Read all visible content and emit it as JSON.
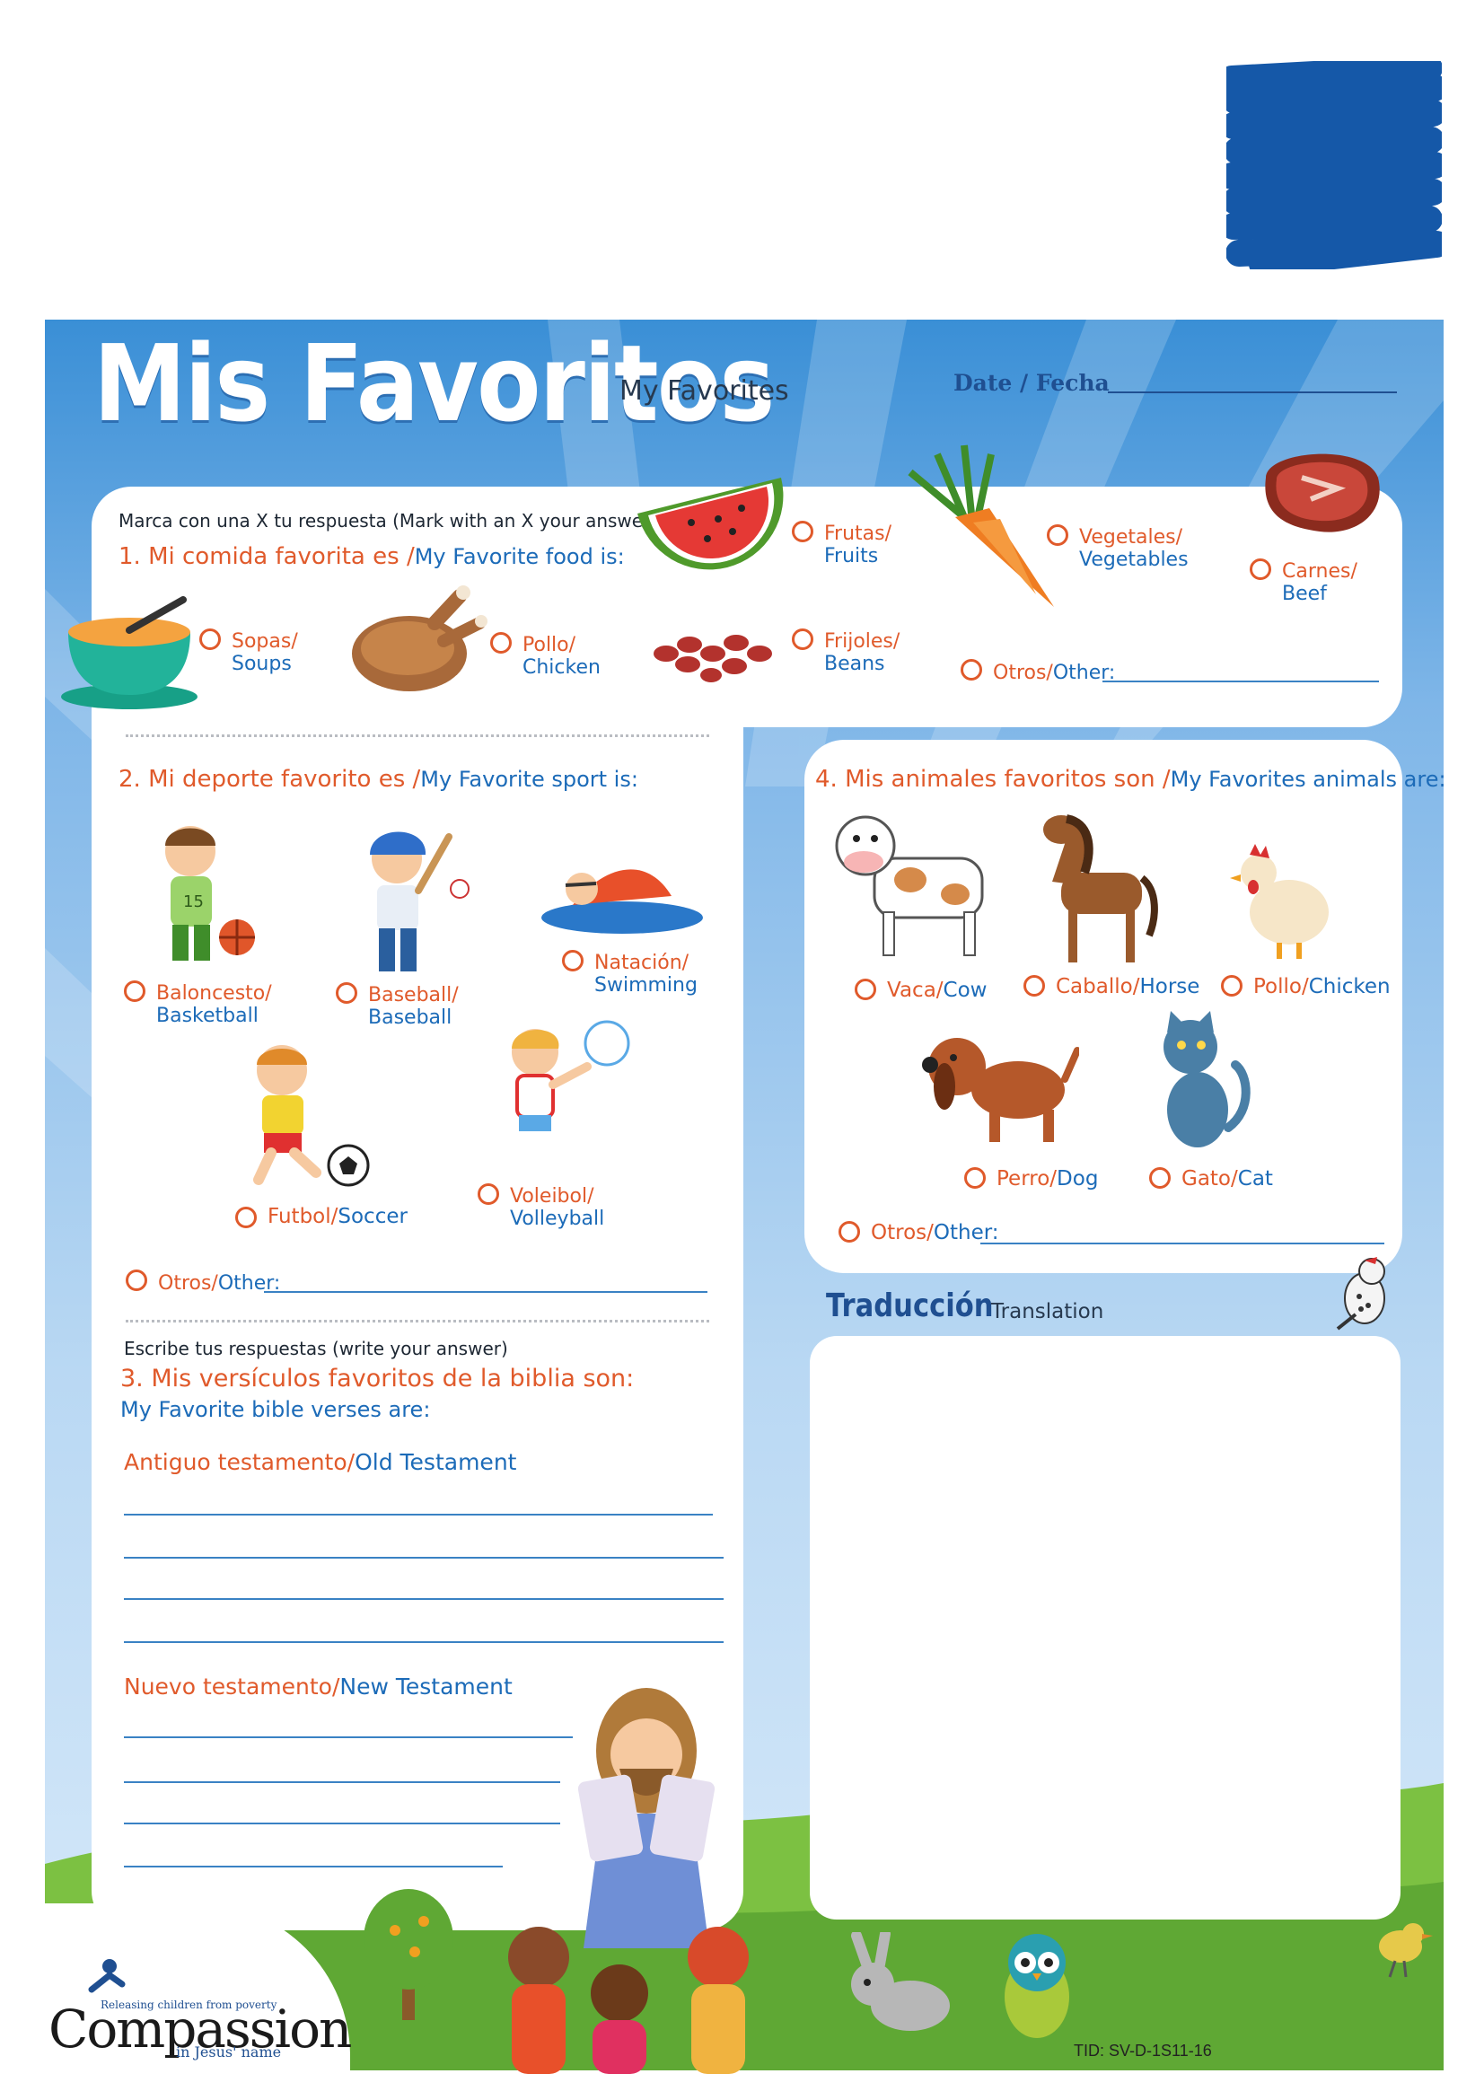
{
  "header": {
    "title": "Mis Favoritos",
    "subtitle": "My  Favorites",
    "date_label": "Date / Fecha"
  },
  "section1": {
    "instruction": "Marca con una X tu respuesta (Mark with an  X  your answer)",
    "question_es": "1. Mi comida favorita es /",
    "question_en": "My Favorite food is:",
    "options": [
      {
        "es": "Frutas/",
        "en": "Fruits",
        "icon": "watermelon-icon"
      },
      {
        "es": "Vegetales/",
        "en": "Vegetables",
        "icon": "carrot-icon"
      },
      {
        "es": "Carnes/",
        "en": "Beef",
        "icon": "steak-icon"
      },
      {
        "es": "Sopas/",
        "en": "Soups",
        "icon": "soup-bowl-icon"
      },
      {
        "es": "Pollo/",
        "en": "Chicken",
        "icon": "roast-chicken-icon"
      },
      {
        "es": "Frijoles/",
        "en": "Beans",
        "icon": "beans-icon"
      }
    ],
    "other": {
      "es": "Otros/",
      "en": "Other:"
    }
  },
  "section2": {
    "question_es": "2. Mi deporte favorito es /",
    "question_en": "My Favorite sport is:",
    "options": [
      {
        "es": "Baloncesto/",
        "en": "Basketball",
        "icon": "basketball-player-icon"
      },
      {
        "es": "Baseball/",
        "en": "Baseball",
        "icon": "baseball-player-icon"
      },
      {
        "es": "Natación/",
        "en": "Swimming",
        "icon": "swimmer-icon"
      },
      {
        "es": "Futbol/",
        "en": "Soccer",
        "icon": "soccer-player-icon"
      },
      {
        "es": "Voleibol/",
        "en": "Volleyball",
        "icon": "volleyball-player-icon"
      }
    ],
    "other": {
      "es": "Otros/",
      "en": "Other:"
    }
  },
  "section3": {
    "instruction": "Escribe  tus respuestas (write your answer)",
    "question_es": "3. Mis versículos  favoritos de la  biblia son:",
    "question_en": "My Favorite bible verses are:",
    "old_es": "Antiguo testamento/",
    "old_en": "Old Testament",
    "new_es": "Nuevo testamento/",
    "new_en": "New Testament"
  },
  "section4": {
    "question_es": "4. Mis animales favoritos son /",
    "question_en": "My Favorites animals are:",
    "options": [
      {
        "es": "Vaca/",
        "en": "Cow",
        "icon": "cow-icon"
      },
      {
        "es": "Caballo/",
        "en": "Horse",
        "icon": "horse-icon"
      },
      {
        "es": "Pollo/",
        "en": "Chicken",
        "icon": "hen-icon"
      },
      {
        "es": "Perro/",
        "en": "Dog",
        "icon": "dog-icon"
      },
      {
        "es": "Gato/",
        "en": "Cat",
        "icon": "cat-icon"
      }
    ],
    "other": {
      "es": "Otros/",
      "en": "Other:"
    }
  },
  "translation": {
    "title": "Traducción",
    "subtitle": "Translation"
  },
  "footer": {
    "logo_name": "Compassion",
    "logo_tagline": "Releasing children from poverty",
    "logo_subline": "in Jesus' name",
    "tid": "TID: SV-D-1S11-16"
  },
  "colors": {
    "accent_orange": "#e05a2b",
    "accent_blue": "#1c6bb8",
    "sky_blue": "#3a8fd6",
    "scribble_blue": "#1558a8",
    "grass_green": "#7cc142"
  }
}
